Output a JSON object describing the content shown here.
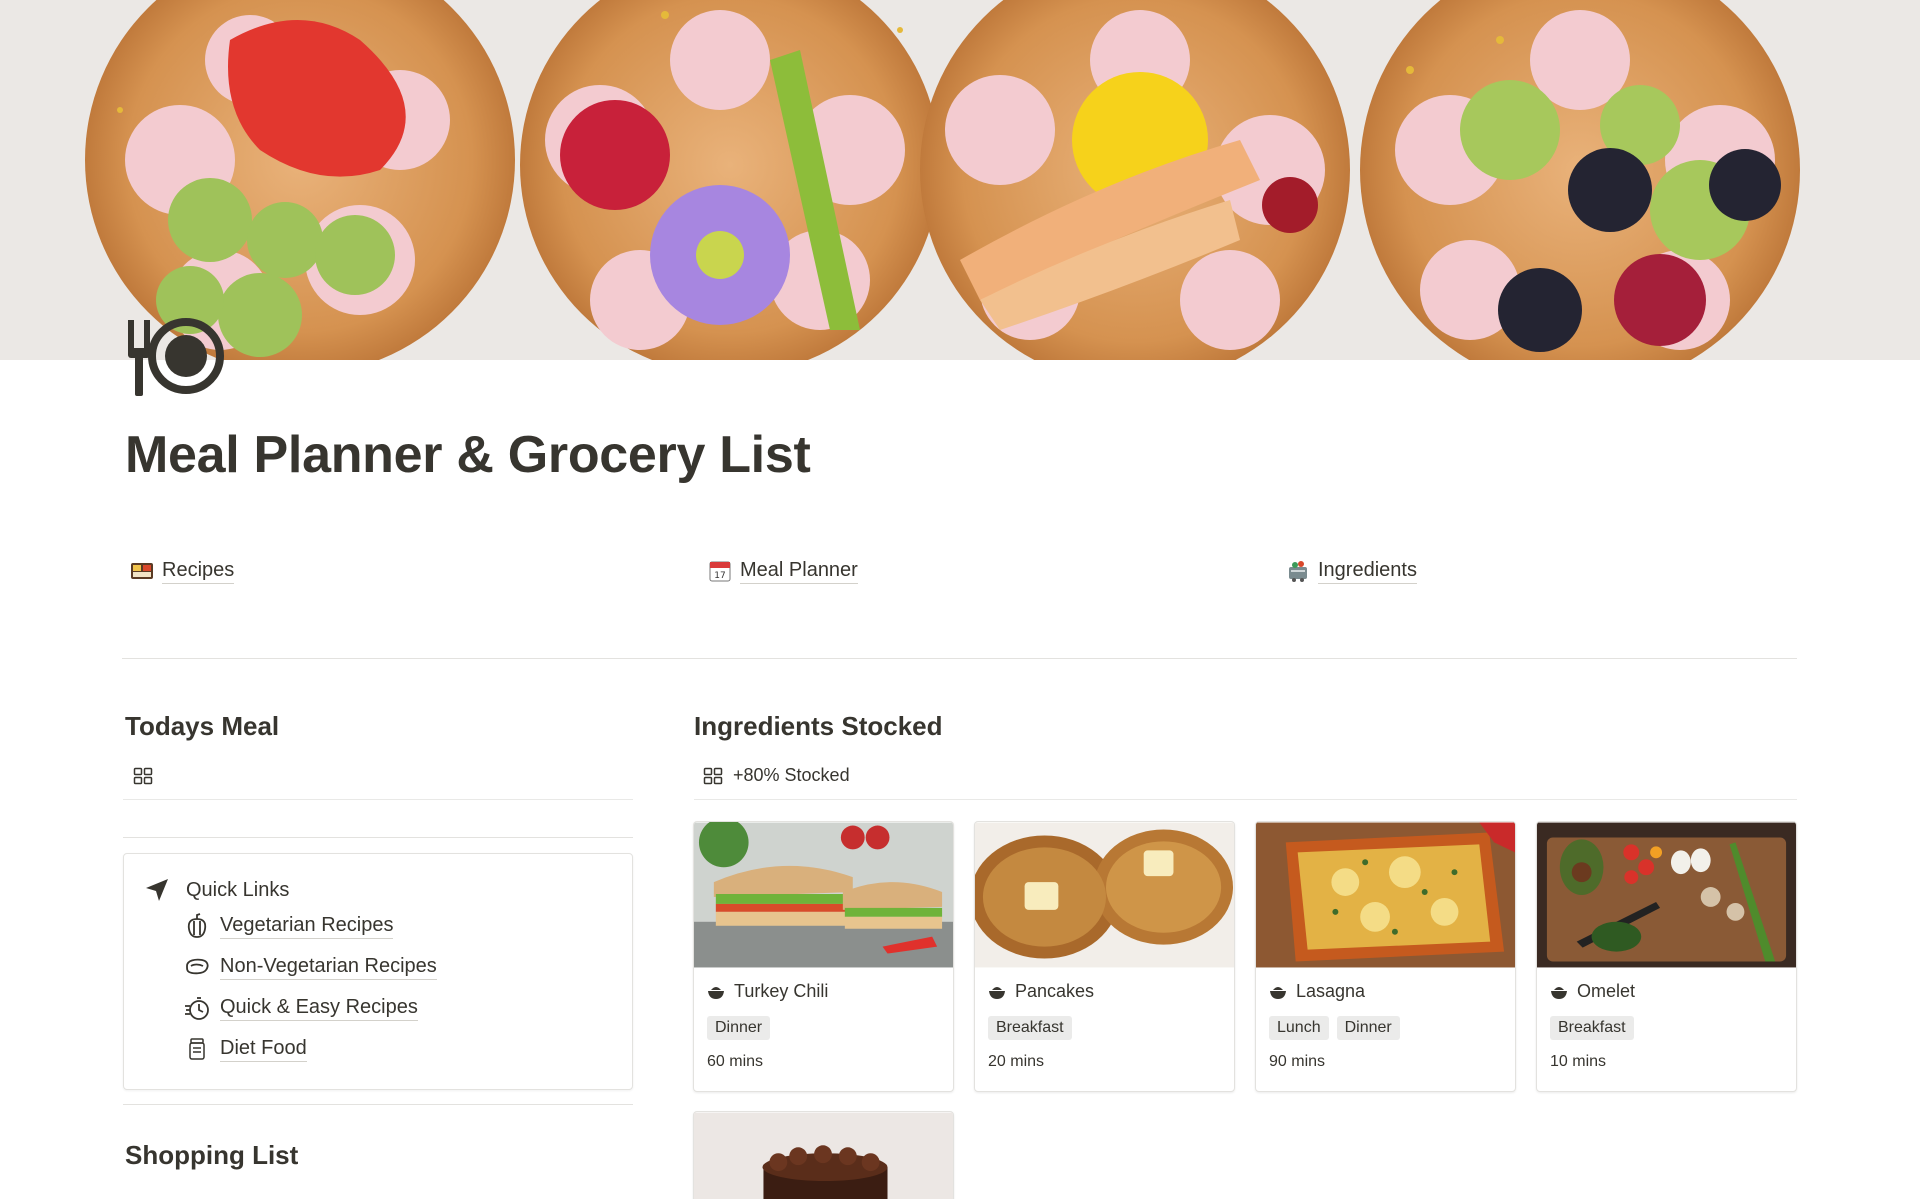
{
  "page": {
    "title": "Meal Planner & Grocery List",
    "icon": "fork-plate-icon"
  },
  "top_links": [
    {
      "label": "Recipes",
      "icon": "bento-box-icon"
    },
    {
      "label": "Meal Planner",
      "icon": "calendar-icon"
    },
    {
      "label": "Ingredients",
      "icon": "grocery-cart-icon"
    }
  ],
  "todays_meal": {
    "heading": "Todays Meal",
    "view_icon": "gallery-view-icon"
  },
  "quick_links": {
    "heading": "Quick Links",
    "icon": "navigation-arrow-icon",
    "items": [
      {
        "label": "Vegetarian Recipes",
        "icon": "bell-pepper-icon"
      },
      {
        "label": "Non-Vegetarian Recipes",
        "icon": "steak-icon"
      },
      {
        "label": "Quick & Easy Recipes",
        "icon": "fast-timer-icon"
      },
      {
        "label": "Diet Food",
        "icon": "jar-icon"
      }
    ]
  },
  "shopping_list": {
    "heading": "Shopping List"
  },
  "ingredients_stocked": {
    "heading": "Ingredients Stocked",
    "view_label": "+80% Stocked",
    "view_icon": "gallery-view-icon"
  },
  "recipes": [
    {
      "name": "Turkey Chili",
      "tags": [
        "Dinner"
      ],
      "time": "60 mins",
      "image": "sandwich-photo"
    },
    {
      "name": "Pancakes",
      "tags": [
        "Breakfast"
      ],
      "time": "20 mins",
      "image": "pancakes-photo"
    },
    {
      "name": "Lasagna",
      "tags": [
        "Lunch",
        "Dinner"
      ],
      "time": "90 mins",
      "image": "lasagna-photo"
    },
    {
      "name": "Omelet",
      "tags": [
        "Breakfast"
      ],
      "time": "10 mins",
      "image": "vegetables-photo"
    },
    {
      "name": "",
      "tags": [],
      "time": "",
      "image": "chocolate-cake-photo"
    }
  ],
  "colors": {
    "text": "#37352f",
    "tag_bg": "#ebebea",
    "divider": "#e3e2df"
  }
}
